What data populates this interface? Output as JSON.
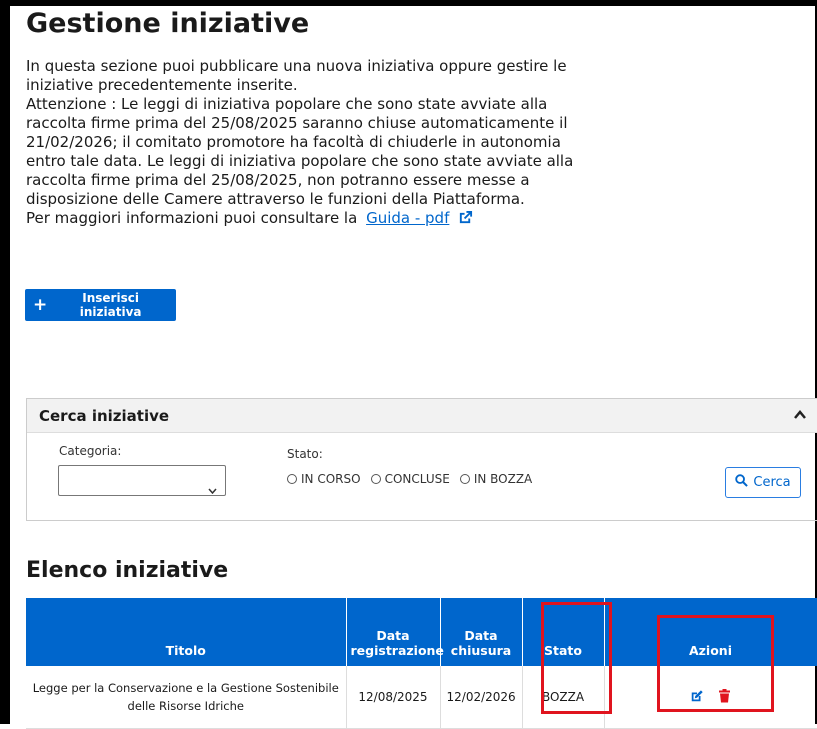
{
  "page": {
    "title": "Gestione iniziative",
    "intro_line1": "In questa sezione puoi pubblicare una nuova iniziativa oppure gestire le iniziative precedentemente inserite.",
    "intro_line2": "Attenzione : Le leggi di iniziativa popolare che sono state avviate alla raccolta firme prima del 25/08/2025 saranno chiuse automaticamente il 21/02/2026; il comitato promotore ha facoltà di chiuderle in autonomia entro tale data. Le leggi di iniziativa popolare che sono state avviate alla raccolta firme prima del 25/08/2025, non potranno essere messe a disposizione delle Camere attraverso le funzioni della Piattaforma.",
    "intro_line3": "Per maggiori informazioni puoi consultare la",
    "guide_link": "Guida - pdf"
  },
  "toolbar": {
    "insert_label": "Inserisci iniziativa"
  },
  "search": {
    "title": "Cerca iniziative",
    "category_label": "Categoria:",
    "category_value": "",
    "status_label": "Stato:",
    "status_options": [
      "IN CORSO",
      "CONCLUSE",
      "IN BOZZA"
    ],
    "search_button": "Cerca"
  },
  "list": {
    "title": "Elenco iniziative",
    "columns": [
      "Titolo",
      "Data registrazione",
      "Data chiusura",
      "Stato",
      "Azioni"
    ],
    "rows": [
      {
        "titolo": "Legge per la Conservazione e la Gestione Sostenibile delle Risorse Idriche",
        "data_registrazione": "12/08/2025",
        "data_chiusura": "12/02/2026",
        "stato": "BOZZA"
      }
    ]
  },
  "icons": {
    "external_link": "external-link-icon",
    "plus": "plus-icon",
    "chevron_up": "chevron-up-icon",
    "caret_down": "chevron-down-icon",
    "search": "search-icon",
    "edit": "edit-icon",
    "delete": "trash-icon"
  },
  "colors": {
    "primary": "#0066cc",
    "highlight": "#e0141e",
    "delete": "#e0141e"
  }
}
